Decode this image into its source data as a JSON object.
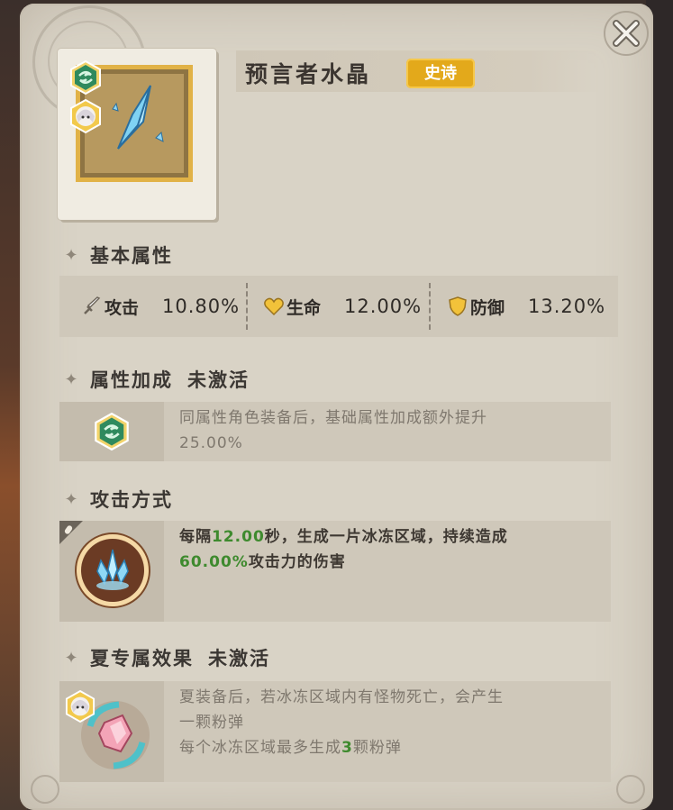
{
  "item": {
    "name": "预言者水晶",
    "rarity": "史诗",
    "icon": "ice-crystal-icon"
  },
  "basic_attributes": {
    "title": "基本属性",
    "stats": [
      {
        "label": "攻击",
        "value": "10.80%",
        "icon": "sword-icon"
      },
      {
        "label": "生命",
        "value": "12.00%",
        "icon": "heart-icon"
      },
      {
        "label": "防御",
        "value": "13.20%",
        "icon": "shield-icon"
      }
    ]
  },
  "attribute_bonus": {
    "title": "属性加成",
    "status": "未激活",
    "line1": "同属性角色装备后，基础属性加成额外提升",
    "line2": "25.00%"
  },
  "attack_mode": {
    "title": "攻击方式",
    "line1_prefix": "每隔",
    "line1_value": "12.00",
    "line1_suffix": "秒，生成一片冰冻区域，持续造成",
    "line2_value": "60.00%",
    "line2_suffix": "攻击力的伤害"
  },
  "exclusive_effect": {
    "title": "夏专属效果",
    "status": "未激活",
    "line1": "夏装备后，若冰冻区域内有怪物死亡，会产生",
    "line2": "一颗粉弹",
    "line3_prefix": "每个冰冻区域最多生成",
    "line3_value": "3",
    "line3_suffix": "颗粉弹"
  },
  "colors": {
    "panel": "#d9d3c6",
    "rarity_epic": "#e3a91b",
    "highlight_green": "#3e8a2e",
    "element_green": "#2f8a5e"
  }
}
